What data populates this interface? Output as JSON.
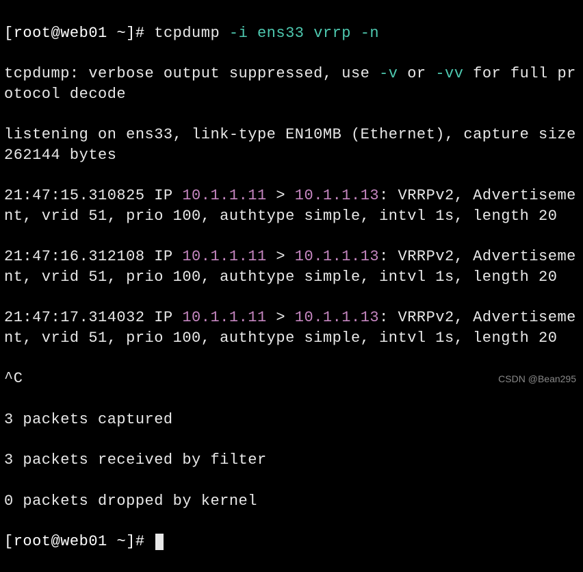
{
  "prompt": {
    "user": "root",
    "host": "web01",
    "dir": "~",
    "symbol": "#"
  },
  "command": {
    "name": "tcpdump",
    "flag_i": "-i",
    "iface": "ens33",
    "filter": "vrrp",
    "flag_n": "-n"
  },
  "msg": {
    "suppress_a": "tcpdump: verbose output suppressed, use ",
    "v_flag": "-v",
    "suppress_b": " or ",
    "vv_flag": "-vv",
    "suppress_c": " for full protocol decode",
    "listening": "listening on ens33, link-type EN10MB (Ethernet), capture size 262144 bytes"
  },
  "packets": [
    {
      "ts": "21:47:15.310825",
      "ip_label": "IP",
      "src": "10.1.1.11",
      "gt": ">",
      "dst": "10.1.1.13",
      "rest": ": VRRPv2, Advertisement, vrid 51, prio 100, authtype simple, intvl 1s, length 20"
    },
    {
      "ts": "21:47:16.312108",
      "ip_label": "IP",
      "src": "10.1.1.11",
      "gt": ">",
      "dst": "10.1.1.13",
      "rest": ": VRRPv2, Advertisement, vrid 51, prio 100, authtype simple, intvl 1s, length 20"
    },
    {
      "ts": "21:47:17.314032",
      "ip_label": "IP",
      "src": "10.1.1.11",
      "gt": ">",
      "dst": "10.1.1.13",
      "rest": ": VRRPv2, Advertisement, vrid 51, prio 100, authtype simple, intvl 1s, length 20"
    }
  ],
  "interrupt": "^C",
  "summary": {
    "captured": "3 packets captured",
    "received": "3 packets received by filter",
    "dropped": "0 packets dropped by kernel"
  },
  "watermark": "CSDN @Bean295"
}
